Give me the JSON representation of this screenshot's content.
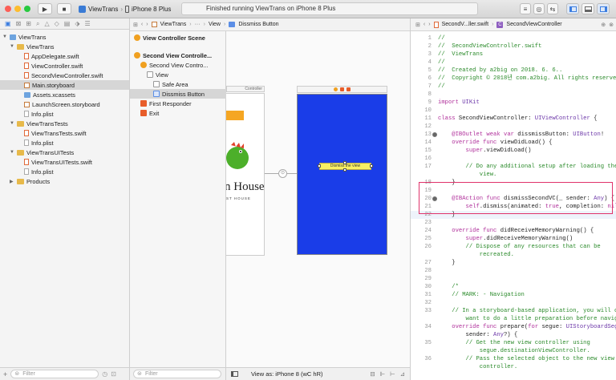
{
  "toolbar": {
    "scheme_name": "ViewTrans",
    "device": "iPhone 8 Plus",
    "status": "Finished running ViewTrans on iPhone 8 Plus"
  },
  "navigator": {
    "tree": [
      {
        "label": "ViewTrans",
        "level": 0,
        "icon": "project-icon",
        "expanded": true
      },
      {
        "label": "ViewTrans",
        "level": 1,
        "icon": "folder-icon",
        "expanded": true
      },
      {
        "label": "AppDelegate.swift",
        "level": 2,
        "icon": "swift-file-icon"
      },
      {
        "label": "ViewController.swift",
        "level": 2,
        "icon": "swift-file-icon"
      },
      {
        "label": "SecondViewController.swift",
        "level": 2,
        "icon": "swift-file-icon"
      },
      {
        "label": "Main.storyboard",
        "level": 2,
        "icon": "storyboard-icon",
        "selected": true
      },
      {
        "label": "Assets.xcassets",
        "level": 2,
        "icon": "assets-icon"
      },
      {
        "label": "LaunchScreen.storyboard",
        "level": 2,
        "icon": "storyboard-icon"
      },
      {
        "label": "Info.plist",
        "level": 2,
        "icon": "plist-icon"
      },
      {
        "label": "ViewTransTests",
        "level": 1,
        "icon": "folder-icon",
        "expanded": true
      },
      {
        "label": "ViewTransTests.swift",
        "level": 2,
        "icon": "swift-file-icon"
      },
      {
        "label": "Info.plist",
        "level": 2,
        "icon": "plist-icon"
      },
      {
        "label": "ViewTransUITests",
        "level": 1,
        "icon": "folder-icon",
        "expanded": true
      },
      {
        "label": "ViewTransUITests.swift",
        "level": 2,
        "icon": "swift-file-icon"
      },
      {
        "label": "Info.plist",
        "level": 2,
        "icon": "plist-icon"
      },
      {
        "label": "Products",
        "level": 1,
        "icon": "folder-icon",
        "expanded": false
      }
    ],
    "filter_placeholder": "Filter"
  },
  "outline": {
    "items": [
      {
        "label": "View Controller Scene",
        "level": 0
      },
      {
        "label": "Second View Controlle...",
        "level": 0
      },
      {
        "label": "Second View Contro...",
        "level": 1
      },
      {
        "label": "View",
        "level": 2
      },
      {
        "label": "Safe Area",
        "level": 3
      },
      {
        "label": "Dissmiss Button",
        "level": 3,
        "selected": true
      },
      {
        "label": "First Responder",
        "level": 1
      },
      {
        "label": "Exit",
        "level": 1
      }
    ],
    "filter_placeholder": "Filter"
  },
  "canvas": {
    "breadcrumb": [
      "View",
      "Dissmiss Button"
    ],
    "left_scene_title": "Controller",
    "left_logo_text": "n House",
    "left_subtitle": "ST HOUSE",
    "button_text": "Dismiss the view",
    "view_as": "View as: iPhone 8 (wC hR)",
    "blue_color": "#1a3de8",
    "orange_color": "#f5a623"
  },
  "editor": {
    "file_name": "SecondV...ller.swift",
    "class_path": "SecondViewController",
    "lines": [
      {
        "n": "1",
        "t": "//"
      },
      {
        "n": "2",
        "t": "//  SecondViewController.swift"
      },
      {
        "n": "3",
        "t": "//  ViewTrans"
      },
      {
        "n": "4",
        "t": "//"
      },
      {
        "n": "5",
        "t": "//  Created by a2big on 2018. 6. 6.."
      },
      {
        "n": "6",
        "t": "//  Copyright © 2018년 com.a2big. All rights reserved."
      },
      {
        "n": "7",
        "t": "//"
      },
      {
        "n": "8",
        "t": ""
      },
      {
        "n": "9",
        "t": "import UIKit"
      },
      {
        "n": "10",
        "t": ""
      },
      {
        "n": "11",
        "t": "class SecondViewController: UIViewController {"
      },
      {
        "n": "12",
        "t": ""
      },
      {
        "n": "13",
        "t": "    @IBOutlet weak var dissmissButton: UIButton!"
      },
      {
        "n": "14",
        "t": "    override func viewDidLoad() {"
      },
      {
        "n": "15",
        "t": "        super.viewDidLoad()"
      },
      {
        "n": "16",
        "t": ""
      },
      {
        "n": "17",
        "t": "        // Do any additional setup after loading the"
      },
      {
        "n": "",
        "t": "            view."
      },
      {
        "n": "18",
        "t": "    }"
      },
      {
        "n": "19",
        "t": ""
      },
      {
        "n": "20",
        "t": "    @IBAction func dismissSecondVC(_ sender: Any) {"
      },
      {
        "n": "21",
        "t": "        self.dismiss(animated: true, completion: nil)"
      },
      {
        "n": "22",
        "t": "    }"
      },
      {
        "n": "23",
        "t": ""
      },
      {
        "n": "24",
        "t": "    override func didReceiveMemoryWarning() {"
      },
      {
        "n": "25",
        "t": "        super.didReceiveMemoryWarning()"
      },
      {
        "n": "26",
        "t": "        // Dispose of any resources that can be"
      },
      {
        "n": "",
        "t": "            recreated."
      },
      {
        "n": "27",
        "t": "    }"
      },
      {
        "n": "28",
        "t": ""
      },
      {
        "n": "29",
        "t": ""
      },
      {
        "n": "30",
        "t": "    /*"
      },
      {
        "n": "31",
        "t": "    // MARK: - Navigation"
      },
      {
        "n": "32",
        "t": ""
      },
      {
        "n": "33",
        "t": "    // In a storyboard-based application, you will often"
      },
      {
        "n": "",
        "t": "        want to do a little preparation before navigation"
      },
      {
        "n": "34",
        "t": "    override func prepare(for segue: UIStoryboardSegue,"
      },
      {
        "n": "",
        "t": "        sender: Any?) {"
      },
      {
        "n": "35",
        "t": "        // Get the new view controller using"
      },
      {
        "n": "",
        "t": "            segue.destinationViewController."
      },
      {
        "n": "36",
        "t": "        // Pass the selected object to the new view"
      },
      {
        "n": "",
        "t": "            controller."
      }
    ]
  }
}
